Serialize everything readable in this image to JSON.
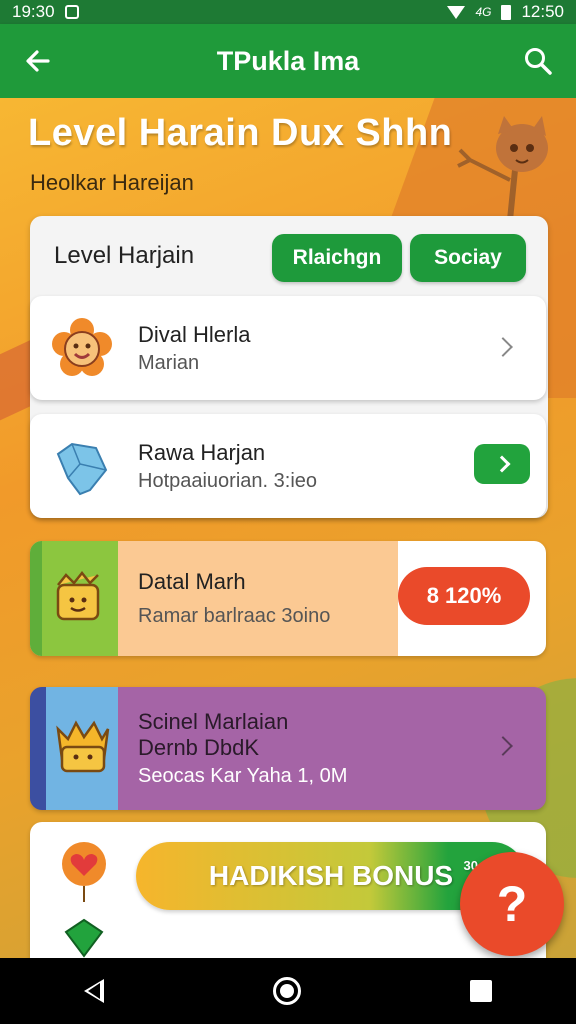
{
  "status_bar": {
    "time_left": "19:30",
    "signal_text": "4G",
    "time_right": "12:50"
  },
  "app_bar": {
    "title": "TPukla Ima",
    "back_icon": "arrow-left-icon",
    "search_icon": "search-icon"
  },
  "hero": {
    "title": "Level Harain Dux Shhn",
    "subtitle": "Heolkar Hareijan",
    "mascot_icon": "fox-mascot-icon"
  },
  "panel": {
    "header": "Level Harjain",
    "btn_primary": "Rlaichgn",
    "btn_secondary": "Sociay"
  },
  "rows": [
    {
      "title": "Dival Hlerla",
      "subtitle": "Marian",
      "icon": "flower-face-icon"
    },
    {
      "title": "Rawa Harjan",
      "subtitle": "Hotpaaiuorian. 3:ieo",
      "icon": "diamond-hand-icon"
    },
    {
      "title": "Datal Marh",
      "subtitle": "Ramar barlraac 3oino",
      "badge": "8 120%",
      "icon": "basket-face-icon"
    },
    {
      "title": "Scinel Marlaian",
      "title2": "Dernb DbdK",
      "subtitle": "Seocas Kar Yaha 1, 0M",
      "icon": "crown-basket-icon"
    }
  ],
  "bonus": {
    "label": "HADIKISH BONUS",
    "tag": "30",
    "icon": "balloon-heart-icon"
  },
  "fab": {
    "glyph": "?",
    "icon": "help-icon"
  },
  "nav": {
    "back": "nav-back-icon",
    "home": "nav-home-icon",
    "recent": "nav-recent-icon"
  },
  "colors": {
    "primary_green": "#1f9a3a",
    "accent_red": "#ea4a2a",
    "purple": "#a564a6"
  }
}
